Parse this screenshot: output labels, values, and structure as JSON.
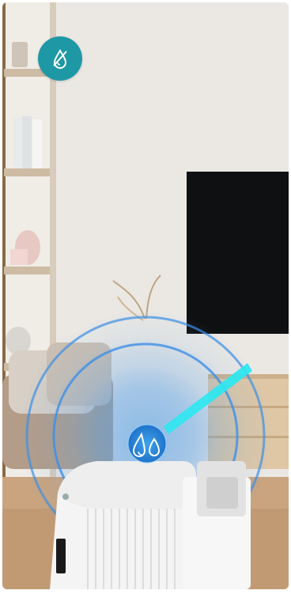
{
  "scene": {
    "description_icons": [
      "dehumidify-mode-icon",
      "water-drops-icon"
    ]
  },
  "colors": {
    "badge_bg": "#1f98a6",
    "ring_blue": "#3c8fe6",
    "beam_cyan": "#2ee7f0"
  }
}
